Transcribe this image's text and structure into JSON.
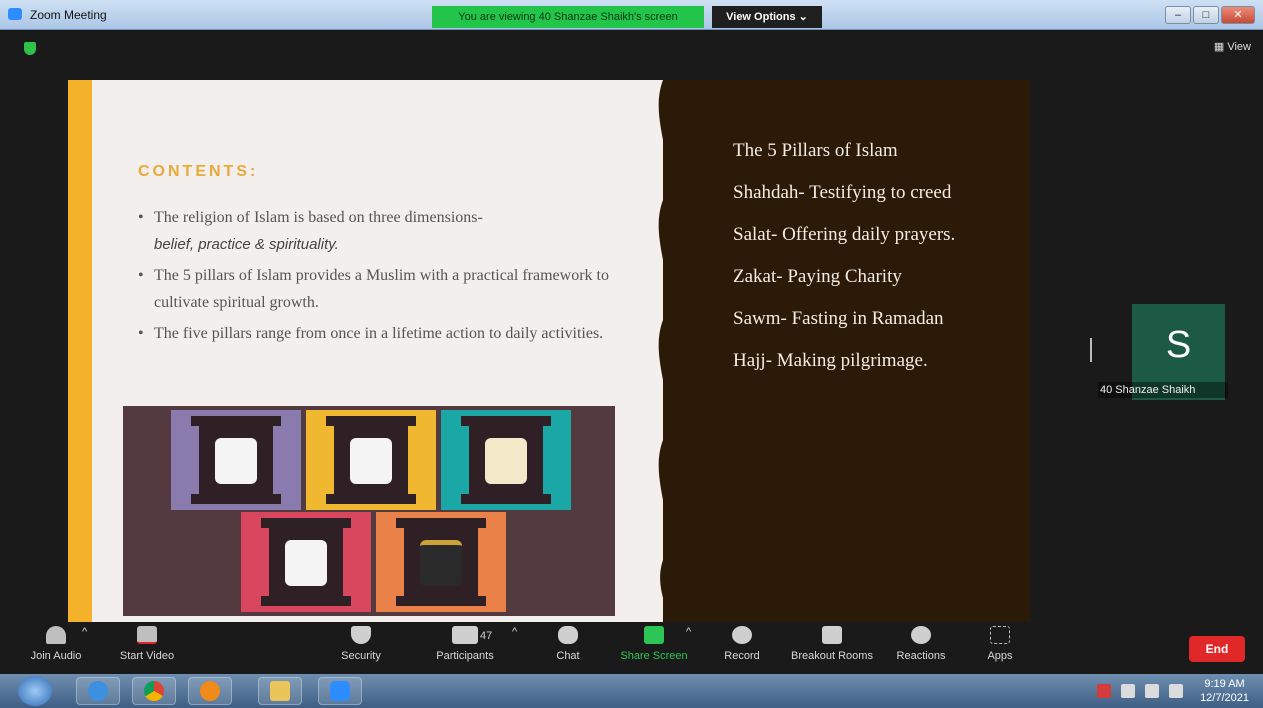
{
  "window": {
    "title": "Zoom Meeting",
    "banner": "You are viewing 40 Shanzae Shaikh's screen",
    "view_options": "View Options ⌄",
    "minimize": "–",
    "maximize": "□",
    "close": "✕"
  },
  "meeting": {
    "view_label": "View"
  },
  "slide": {
    "contents_title": "CONTENTS:",
    "bullets": [
      {
        "text": "The religion of Islam is based on three dimensions-",
        "italic": "belief, practice & spirituality."
      },
      {
        "text": "The 5 pillars of Islam provides a Muslim with a practical framework to cultivate spiritual growth."
      },
      {
        "text": "The five pillars range from once in a lifetime action to daily activities."
      }
    ],
    "right_items": [
      "The 5 Pillars of Islam",
      "Shahdah- Testifying to creed",
      "Salat- Offering daily prayers.",
      "Zakat- Paying Charity",
      "Sawm- Fasting in Ramadan",
      "Hajj- Making pilgrimage."
    ],
    "pillar_colors": [
      "#8a7bae",
      "#f0b831",
      "#1aa7a5",
      "#d9475e",
      "#ea8148"
    ]
  },
  "participant": {
    "initial": "S",
    "name": "40 Shanzae Shaikh"
  },
  "toolbar": {
    "join_audio": "Join Audio",
    "start_video": "Start Video",
    "security": "Security",
    "participants": "Participants",
    "participants_count": "47",
    "chat": "Chat",
    "share_screen": "Share Screen",
    "record": "Record",
    "breakout_rooms": "Breakout Rooms",
    "reactions": "Reactions",
    "apps": "Apps",
    "end": "End"
  },
  "taskbar": {
    "time": "9:19 AM",
    "date": "12/7/2021"
  }
}
